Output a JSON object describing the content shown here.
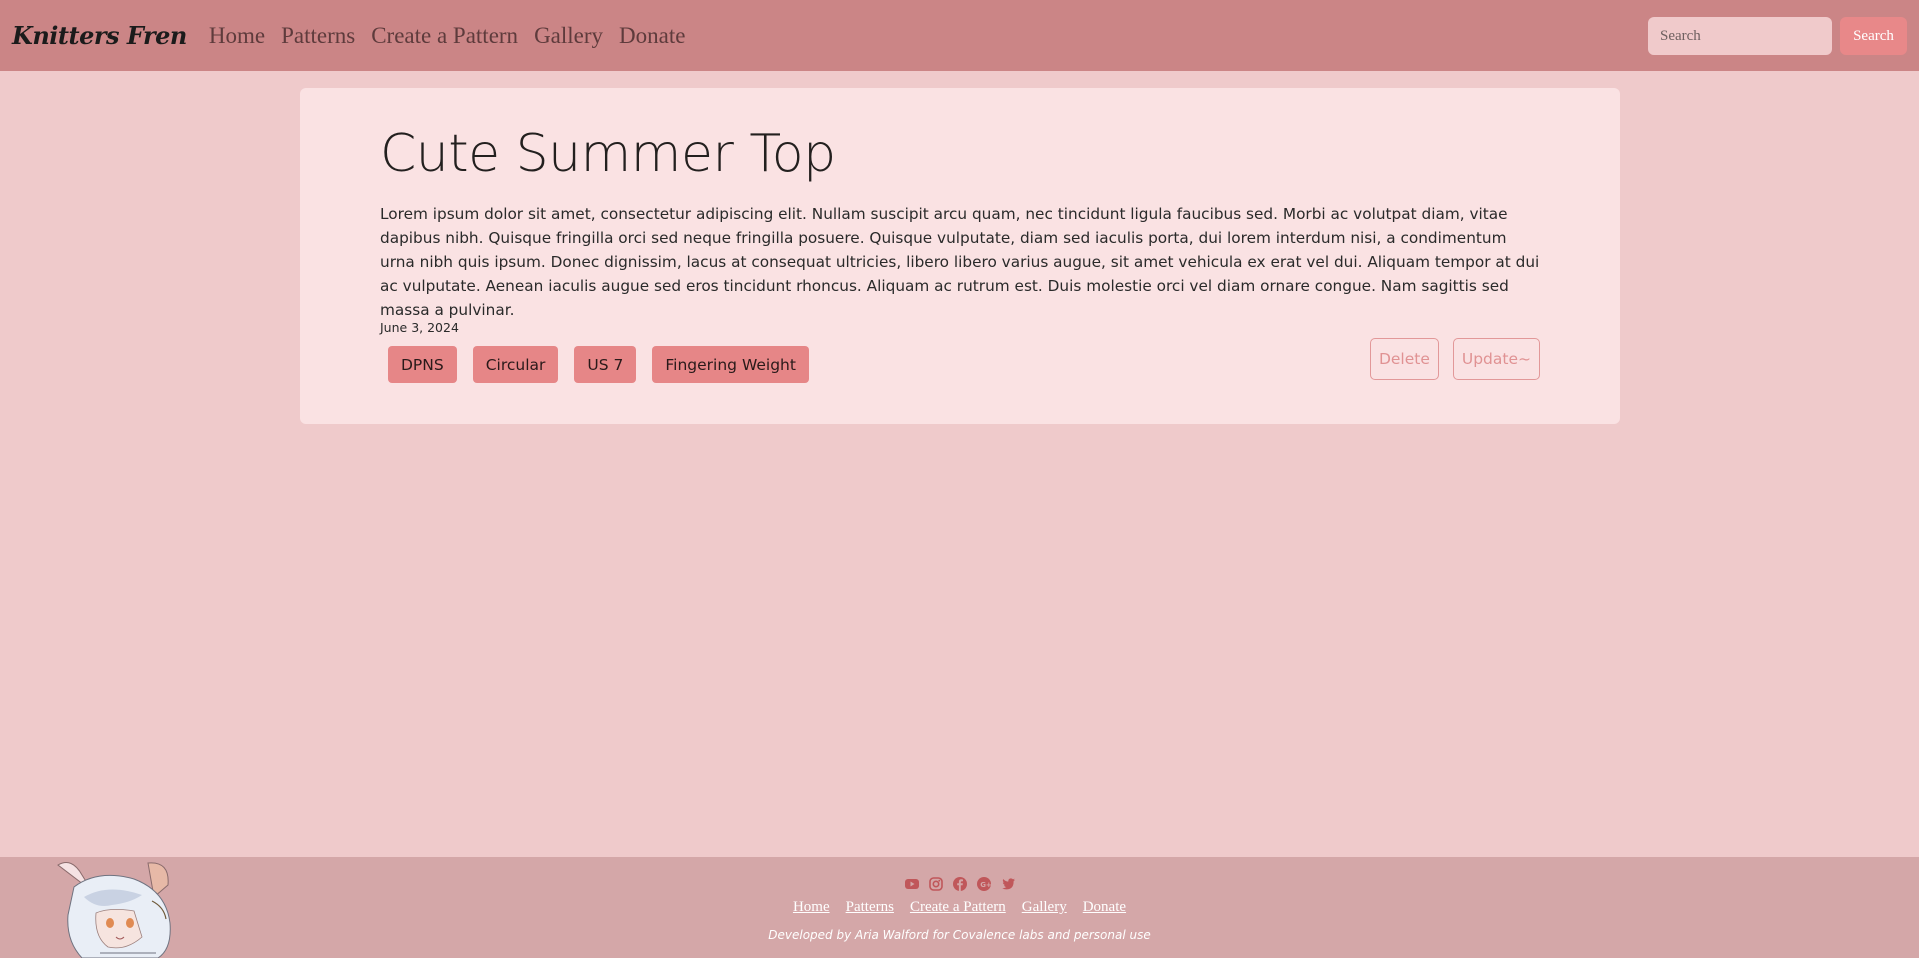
{
  "nav": {
    "brand": "Knitters Fren",
    "links": [
      "Home",
      "Patterns",
      "Create a Pattern",
      "Gallery",
      "Donate"
    ],
    "search_placeholder": "Search",
    "search_button": "Search"
  },
  "pattern": {
    "title": "Cute Summer Top",
    "description": "Lorem ipsum dolor sit amet, consectetur adipiscing elit. Nullam suscipit arcu quam, nec tincidunt ligula faucibus sed. Morbi ac volutpat diam, vitae dapibus nibh. Quisque fringilla orci sed neque fringilla posuere. Quisque vulputate, diam sed iaculis porta, dui lorem interdum nisi, a condimentum urna nibh quis ipsum. Donec dignissim, lacus at consequat ultricies, libero libero varius augue, sit amet vehicula ex erat vel dui. Aliquam tempor at dui ac vulputate. Aenean iaculis augue sed eros tincidunt rhoncus. Aliquam ac rutrum est. Duis molestie orci vel diam ornare congue. Nam sagittis sed massa a pulvinar.",
    "date": "June 3, 2024",
    "tags": [
      "DPNS",
      "Circular",
      "US 7",
      "Fingering Weight"
    ],
    "delete_label": "Delete",
    "update_label": "Update~"
  },
  "footer": {
    "social_icons": [
      "youtube-icon",
      "instagram-icon",
      "facebook-icon",
      "google-plus-icon",
      "twitter-icon"
    ],
    "links": [
      "Home",
      "Patterns",
      "Create a Pattern",
      "Gallery",
      "Donate"
    ],
    "credit": "Developed by Aria Walford for Covalence labs and personal use"
  },
  "colors": {
    "navbar": "#cb8586",
    "page_bg": "#efcacb",
    "card_bg": "#fae2e3",
    "tag_bg": "#e68687",
    "accent": "#e88889",
    "footer_bg": "#d4a7a8",
    "social_icon": "#c0575a"
  }
}
